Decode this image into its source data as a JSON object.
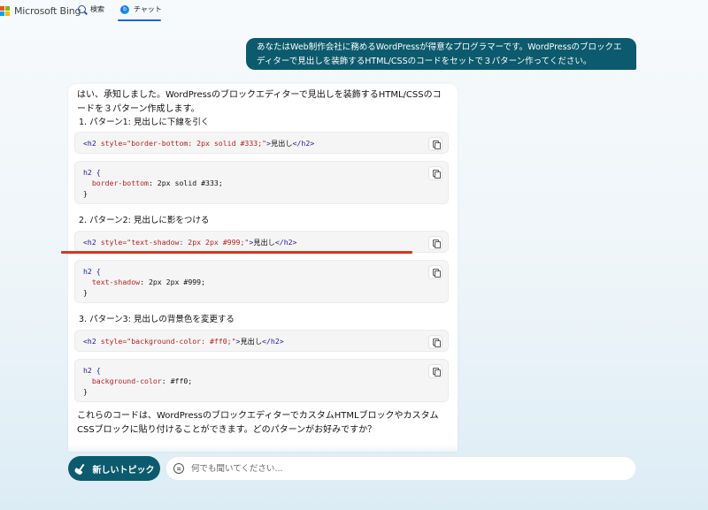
{
  "header": {
    "logo_text": "Microsoft Bing",
    "tabs": [
      {
        "label": "検索"
      },
      {
        "label": "チャット"
      }
    ]
  },
  "user_message": "あなたはWeb制作会社に務めるWordPressが得意なプログラマーです。WordPressのブロックエディターで見出しを装飾するHTML/CSSのコードをセットで３パターン作ってください。",
  "bot": {
    "intro": "はい、承知しました。WordPressのブロックエディターで見出しを装飾するHTML/CSSのコードを３パターン作成します。",
    "patterns": [
      {
        "label": "1. パターン1: 見出しに下線を引く",
        "html_code": {
          "open_tag": "<h2 ",
          "attr": "style=\"border-bottom: 2px solid #333;\"",
          "close_bracket": ">",
          "text": "見出し",
          "end_tag": "</h2>"
        },
        "css_code": {
          "selector": "h2 {",
          "property": "border-bottom",
          "value": ": 2px solid #333;",
          "close": "}"
        }
      },
      {
        "label": "2. パターン2: 見出しに影をつける",
        "html_code": {
          "open_tag": "<h2 ",
          "attr": "style=\"text-shadow: 2px 2px #999;\"",
          "close_bracket": ">",
          "text": "見出し",
          "end_tag": "</h2>"
        },
        "css_code": {
          "selector": "h2 {",
          "property": "text-shadow",
          "value": ": 2px 2px #999;",
          "close": "}"
        }
      },
      {
        "label": "3. パターン3: 見出しの背景色を変更する",
        "html_code": {
          "open_tag": "<h2 ",
          "attr": "style=\"background-color: #ff0;\"",
          "close_bracket": ">",
          "text": "見出し",
          "end_tag": "</h2>"
        },
        "css_code": {
          "selector": "h2 {",
          "property": "background-color",
          "value": ": #ff0;",
          "close": "}"
        }
      }
    ],
    "outro": "これらのコードは、WordPressのブロックエディターでカスタムHTMLブロックやカスタムCSSブロックに貼り付けることができます。どのパターンがお好みですか？"
  },
  "bottom": {
    "new_topic_label": "新しいトピック",
    "ask_placeholder": "何でも聞いてください..."
  },
  "colors": {
    "accent": "#0c5a6d",
    "tab_underline": "#1b64e8",
    "annotation_line": "#d8361c",
    "code_tag": "#22219b",
    "code_attr": "#b32324"
  }
}
